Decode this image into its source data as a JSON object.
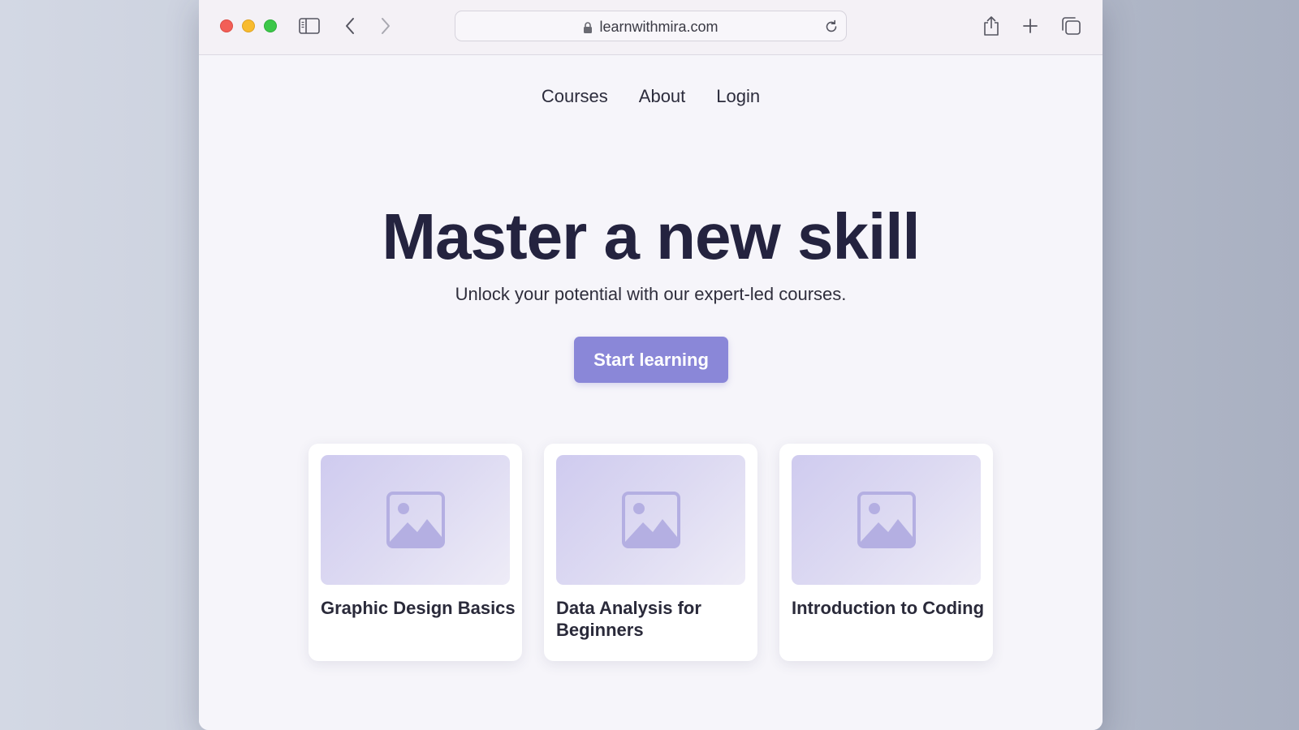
{
  "browser": {
    "url": "learnwithmira.com",
    "icons": {
      "sidebar": "sidebar-icon",
      "back": "chevron-left-icon",
      "forward": "chevron-right-icon",
      "lock": "lock-icon",
      "reload": "reload-icon",
      "share": "share-icon",
      "new_tab": "plus-icon",
      "tabs": "tabs-overview-icon"
    }
  },
  "nav": {
    "items": [
      "Courses",
      "About",
      "Login"
    ]
  },
  "hero": {
    "title": "Master a new skill",
    "subtitle": "Unlock your potential with our expert-led courses.",
    "cta_label": "Start learning"
  },
  "courses": [
    {
      "title": "Graphic Design Basics",
      "image_icon": "image-placeholder-icon"
    },
    {
      "title": "Data Analysis for Beginners",
      "image_icon": "image-placeholder-icon"
    },
    {
      "title": "Introduction to Coding",
      "image_icon": "image-placeholder-icon"
    }
  ],
  "colors": {
    "accent": "#8a87d8",
    "heading": "#24233f",
    "background": "#f6f5fa"
  }
}
